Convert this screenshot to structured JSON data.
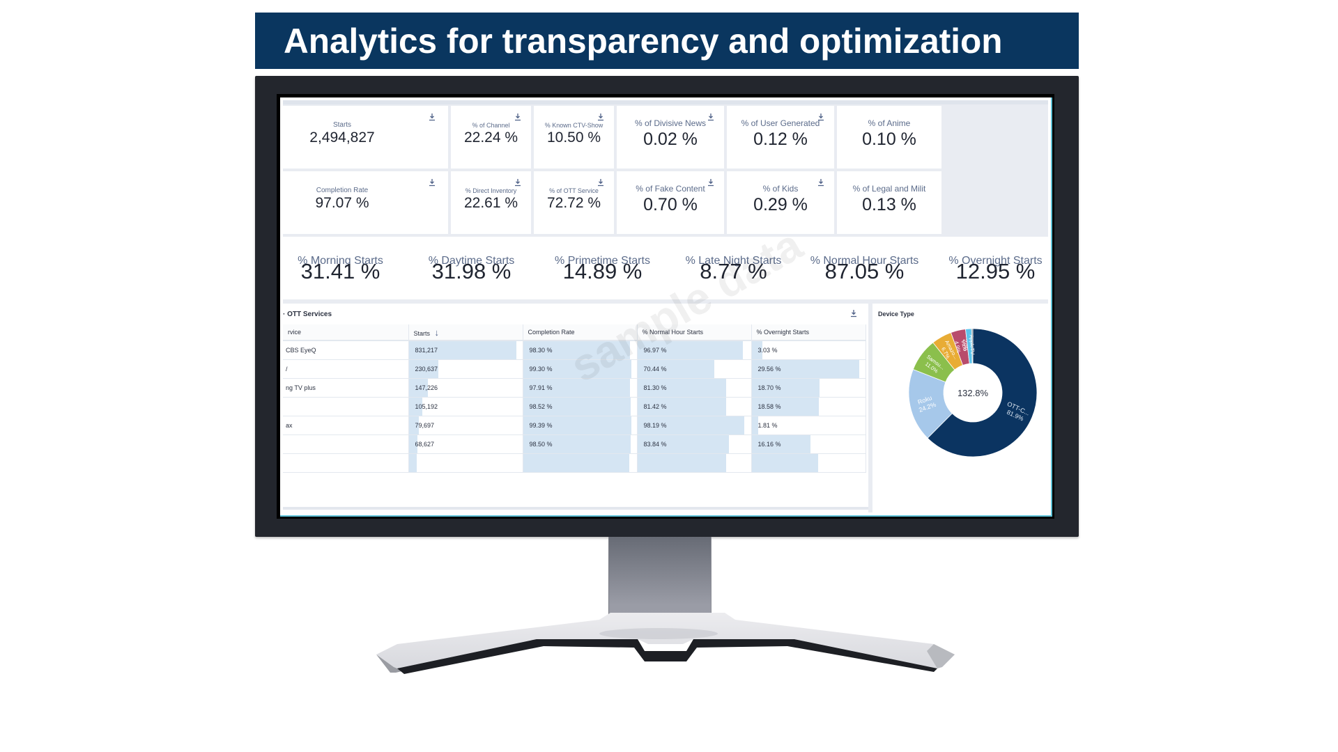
{
  "header": {
    "title": "Analytics for transparency and optimization"
  },
  "kpi_cards": [
    {
      "label": "Starts",
      "value": "2,494,827",
      "download": true
    },
    {
      "label": "% of Channel",
      "value": "22.24 %",
      "download": true
    },
    {
      "label": "% Known CTV-Show",
      "value": "10.50 %",
      "download": true
    },
    {
      "label": "% of Divisive News",
      "value": "0.02 %",
      "download": true
    },
    {
      "label": "% of User Generated",
      "value": "0.12 %",
      "download": true
    },
    {
      "label": "% of Anime",
      "value": "0.10 %",
      "download": false
    },
    {
      "label": "Completion Rate",
      "value": "97.07 %",
      "download": true
    },
    {
      "label": "% Direct Inventory",
      "value": "22.61 %",
      "download": true
    },
    {
      "label": "% of OTT Service",
      "value": "72.72 %",
      "download": true
    },
    {
      "label": "% of Fake Content",
      "value": "0.70 %",
      "download": true
    },
    {
      "label": "% of Kids",
      "value": "0.29 %",
      "download": true
    },
    {
      "label": "% of Legal and Milit",
      "value": "0.13 %",
      "download": false
    }
  ],
  "time_metrics": [
    {
      "label": "% Morning Starts",
      "value": "31.41 %"
    },
    {
      "label": "% Daytime Starts",
      "value": "31.98 %"
    },
    {
      "label": "% Primetime Starts",
      "value": "14.89 %"
    },
    {
      "label": "% Late Night Starts",
      "value": "8.77 %"
    },
    {
      "label": "% Normal Hour Starts",
      "value": "87.05 %"
    },
    {
      "label": "% Overnight Starts",
      "value": "12.95 %"
    }
  ],
  "ott_table": {
    "title": "· OTT Services",
    "columns": [
      "rvice",
      "Starts",
      "Completion Rate",
      "% Normal Hour Starts",
      "% Overnight Starts"
    ],
    "sort_indicator": "↓",
    "rows": [
      {
        "service": "CBS EyeQ",
        "starts": "831,217",
        "starts_frac": 1.0,
        "completion": "98.30 %",
        "completion_pct": 98.3,
        "normal": "96.97 %",
        "normal_pct": 96.97,
        "overnight": "3.03 %",
        "overnight_pct": 3.03
      },
      {
        "service": "/",
        "starts": "230,637",
        "starts_frac": 0.277,
        "completion": "99.30 %",
        "completion_pct": 99.3,
        "normal": "70.44 %",
        "normal_pct": 70.44,
        "overnight": "29.56 %",
        "overnight_pct": 29.56
      },
      {
        "service": "ng TV plus",
        "starts": "147,226",
        "starts_frac": 0.177,
        "completion": "97.91 %",
        "completion_pct": 97.91,
        "normal": "81.30 %",
        "normal_pct": 81.3,
        "overnight": "18.70 %",
        "overnight_pct": 18.7
      },
      {
        "service": "",
        "starts": "105,192",
        "starts_frac": 0.127,
        "completion": "98.52 %",
        "completion_pct": 98.52,
        "normal": "81.42 %",
        "normal_pct": 81.42,
        "overnight": "18.58 %",
        "overnight_pct": 18.58
      },
      {
        "service": "ax",
        "starts": "79,697",
        "starts_frac": 0.096,
        "completion": "99.39 %",
        "completion_pct": 99.39,
        "normal": "98.19 %",
        "normal_pct": 98.19,
        "overnight": "1.81 %",
        "overnight_pct": 1.81
      },
      {
        "service": "",
        "starts": "68,627",
        "starts_frac": 0.083,
        "completion": "98.50 %",
        "completion_pct": 98.5,
        "normal": "83.84 %",
        "normal_pct": 83.84,
        "overnight": "16.16 %",
        "overnight_pct": 16.16
      },
      {
        "service": "",
        "starts": "",
        "starts_frac": 0.075,
        "completion": "",
        "completion_pct": 97.5,
        "normal": "",
        "normal_pct": 81.7,
        "overnight": "",
        "overnight_pct": 18.3
      }
    ]
  },
  "device_type": {
    "title": "Device Type",
    "center_label": "132.8%",
    "slices": [
      {
        "label": "OTT-C...",
        "pct": "81.9%",
        "value": 81.9,
        "color": "#0b3461"
      },
      {
        "label": "Roku",
        "pct": "24.2%",
        "value": 24.2,
        "color": "#a6c8ea"
      },
      {
        "label": "Samsu...",
        "pct": "11.0%",
        "value": 11.0,
        "color": "#8bbf4c"
      },
      {
        "label": "Amazo...",
        "pct": "6.7%",
        "value": 6.7,
        "color": "#e8ac35"
      },
      {
        "label": "Vizio",
        "pct": "4.9%",
        "value": 4.9,
        "color": "#b84c6c"
      },
      {
        "label": "AppleTV",
        "pct": "2.0%",
        "value": 2.0,
        "color": "#5cc4ec"
      },
      {
        "label": "",
        "pct": "",
        "value": 0.4,
        "color": "#7c7f86"
      }
    ]
  },
  "watermark": "sample data"
}
